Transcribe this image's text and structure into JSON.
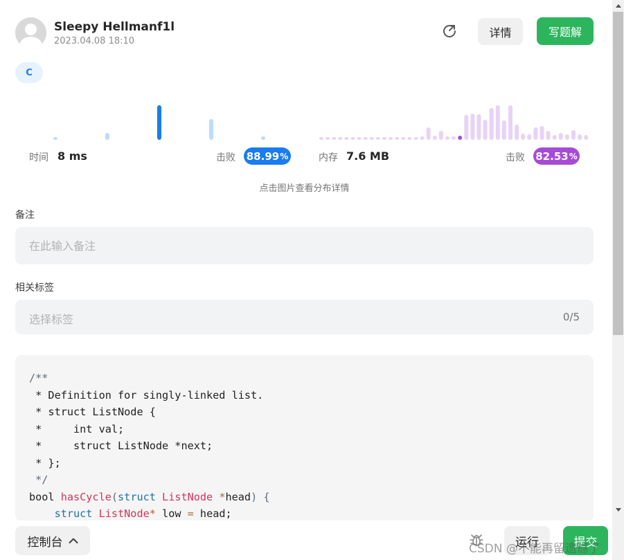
{
  "header": {
    "username": "Sleepy Hellmanf1l",
    "date": "2023.04.08 18:10",
    "detail_label": "详情",
    "write_solution_label": "写题解"
  },
  "language_tag": "C",
  "runtime": {
    "label": "时间",
    "value": "8 ms",
    "beat_label": "击败",
    "beat_int": "88.99",
    "beat_unit": "%",
    "beat_percent": 88.99,
    "color": "#1a7cf0",
    "bars_light_color": "#bcdcf9",
    "bars": [
      {
        "level": 0.08,
        "highlight": false
      },
      {
        "level": 0.2,
        "highlight": false
      },
      {
        "level": 1.0,
        "highlight": true
      },
      {
        "level": 0.6,
        "highlight": false
      },
      {
        "level": 0.1,
        "highlight": false
      }
    ]
  },
  "memory": {
    "label": "内存",
    "value": "7.6 MB",
    "beat_label": "击败",
    "beat_int": "82.53",
    "beat_unit": "%",
    "beat_percent": 82.53,
    "color": "#a64bd6",
    "bars_light_color": "#e8d3f5",
    "bars": [
      {
        "level": 0.06,
        "highlight": false
      },
      {
        "level": 0.06,
        "highlight": false
      },
      {
        "level": 0.06,
        "highlight": false
      },
      {
        "level": 0.06,
        "highlight": false
      },
      {
        "level": 0.06,
        "highlight": false
      },
      {
        "level": 0.06,
        "highlight": false
      },
      {
        "level": 0.06,
        "highlight": false
      },
      {
        "level": 0.06,
        "highlight": false
      },
      {
        "level": 0.06,
        "highlight": false
      },
      {
        "level": 0.06,
        "highlight": false
      },
      {
        "level": 0.06,
        "highlight": false
      },
      {
        "level": 0.06,
        "highlight": false
      },
      {
        "level": 0.06,
        "highlight": false
      },
      {
        "level": 0.06,
        "highlight": false
      },
      {
        "level": 0.06,
        "highlight": false
      },
      {
        "level": 0.06,
        "highlight": false
      },
      {
        "level": 0.1,
        "highlight": false
      },
      {
        "level": 0.36,
        "highlight": false
      },
      {
        "level": 0.12,
        "highlight": false
      },
      {
        "level": 0.26,
        "highlight": false
      },
      {
        "level": 0.1,
        "highlight": false
      },
      {
        "level": 0.1,
        "highlight": false
      },
      {
        "level": 0.12,
        "highlight": true
      },
      {
        "level": 0.72,
        "highlight": false
      },
      {
        "level": 0.76,
        "highlight": false
      },
      {
        "level": 0.74,
        "highlight": false
      },
      {
        "level": 0.58,
        "highlight": false
      },
      {
        "level": 0.92,
        "highlight": false
      },
      {
        "level": 1.0,
        "highlight": false
      },
      {
        "level": 0.56,
        "highlight": false
      },
      {
        "level": 1.0,
        "highlight": false
      },
      {
        "level": 0.44,
        "highlight": false
      },
      {
        "level": 0.18,
        "highlight": false
      },
      {
        "level": 0.16,
        "highlight": false
      },
      {
        "level": 0.36,
        "highlight": false
      },
      {
        "level": 0.4,
        "highlight": false
      },
      {
        "level": 0.26,
        "highlight": false
      },
      {
        "level": 0.14,
        "highlight": false
      },
      {
        "level": 0.2,
        "highlight": false
      },
      {
        "level": 0.16,
        "highlight": false
      },
      {
        "level": 0.28,
        "highlight": false
      },
      {
        "level": 0.16,
        "highlight": false
      },
      {
        "level": 0.14,
        "highlight": false
      }
    ]
  },
  "distribution_hint": "点击图片查看分布详情",
  "note": {
    "label": "备注",
    "placeholder": "在此输入备注"
  },
  "tags": {
    "label": "相关标签",
    "placeholder": "选择标签",
    "count": "0/5"
  },
  "code_lines": [
    [
      {
        "t": "/**",
        "c": "cm"
      }
    ],
    [
      {
        "t": " * Definition for singly-linked list.",
        "c": "pl"
      }
    ],
    [
      {
        "t": " * struct ListNode {",
        "c": "pl"
      }
    ],
    [
      {
        "t": " *     int val;",
        "c": "pl"
      }
    ],
    [
      {
        "t": " *     struct ListNode *next;",
        "c": "pl"
      }
    ],
    [
      {
        "t": " * };",
        "c": "pl"
      }
    ],
    [
      {
        "t": " */",
        "c": "cm"
      }
    ],
    [
      {
        "t": "bool ",
        "c": "pl"
      },
      {
        "t": "hasCycle",
        "c": "fn"
      },
      {
        "t": "(",
        "c": "cm"
      },
      {
        "t": "struct ",
        "c": "kw"
      },
      {
        "t": "ListNode ",
        "c": "ty"
      },
      {
        "t": "*",
        "c": "op"
      },
      {
        "t": "head",
        "c": "pl"
      },
      {
        "t": ") {",
        "c": "cm"
      }
    ],
    [
      {
        "t": "    ",
        "c": "pl"
      },
      {
        "t": "struct ",
        "c": "kw"
      },
      {
        "t": "ListNode",
        "c": "ty"
      },
      {
        "t": "* ",
        "c": "op"
      },
      {
        "t": "low ",
        "c": "pl"
      },
      {
        "t": "= ",
        "c": "op"
      },
      {
        "t": "head;",
        "c": "pl"
      }
    ]
  ],
  "footer": {
    "console_label": "控制台",
    "run_label": "运行",
    "submit_label": "提交"
  },
  "watermark": "CSDN @不能再留遗憾了",
  "colors": {
    "accent_green": "#2db55d",
    "runtime_blue": "#1a7cf0",
    "memory_purple": "#a64bd6"
  }
}
